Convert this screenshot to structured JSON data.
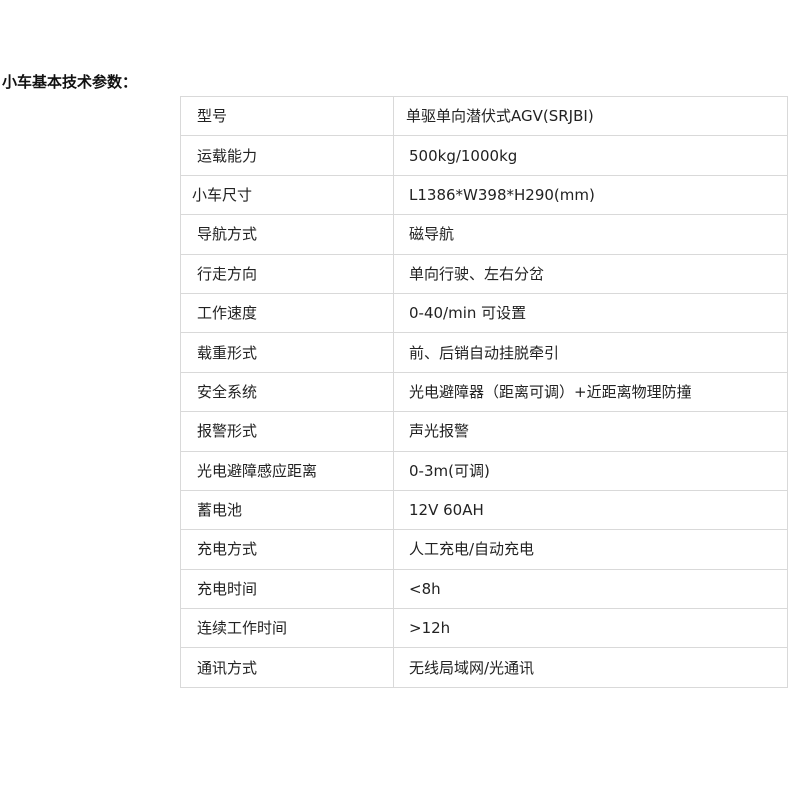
{
  "section": {
    "title": "小车基本技术参数："
  },
  "spec_table": {
    "rows": [
      {
        "param": "型号",
        "value": "单驱单向潜伏式AGV(SRJBⅠ)"
      },
      {
        "param": "运载能力",
        "value": "500kg/1000kg"
      },
      {
        "param": "小车尺寸",
        "value": "L1386*W398*H290(mm)"
      },
      {
        "param": "导航方式",
        "value": "磁导航"
      },
      {
        "param": "行走方向",
        "value": "单向行驶、左右分岔"
      },
      {
        "param": "工作速度",
        "value": "0-40/min 可设置"
      },
      {
        "param": "载重形式",
        "value": "前、后销自动挂脱牵引"
      },
      {
        "param": "安全系统",
        "value": "光电避障器（距离可调）+近距离物理防撞"
      },
      {
        "param": "报警形式",
        "value": "声光报警"
      },
      {
        "param": "光电避障感应距离",
        "value": "0-3m(可调)"
      },
      {
        "param": "蓄电池",
        "value": "12V 60AH"
      },
      {
        "param": "充电方式",
        "value": "人工充电/自动充电"
      },
      {
        "param": "充电时间",
        "value": "<8h"
      },
      {
        "param": "连续工作时间",
        "value": ">12h"
      },
      {
        "param": "通讯方式",
        "value": "无线局域网/光通讯"
      }
    ]
  }
}
